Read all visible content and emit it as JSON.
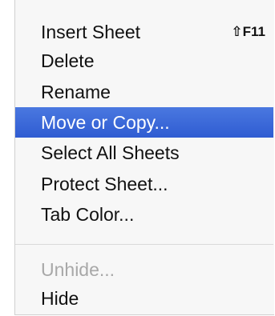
{
  "menu": {
    "items": [
      {
        "label": "Insert Sheet",
        "shortcut": "⇧F11",
        "enabled": true,
        "highlighted": false
      },
      {
        "label": "Delete",
        "enabled": true,
        "highlighted": false
      },
      {
        "label": "Rename",
        "enabled": true,
        "highlighted": false
      },
      {
        "label": "Move or Copy...",
        "enabled": true,
        "highlighted": true
      },
      {
        "label": "Select All Sheets",
        "enabled": true,
        "highlighted": false
      },
      {
        "label": "Protect Sheet...",
        "enabled": true,
        "highlighted": false
      },
      {
        "label": "Tab Color...",
        "enabled": true,
        "highlighted": false
      },
      {
        "label": "Unhide...",
        "enabled": false,
        "highlighted": false
      },
      {
        "label": "Hide",
        "enabled": true,
        "highlighted": false
      }
    ],
    "colors": {
      "highlight": "#3a66d8",
      "disabled_text": "#a8a8a8",
      "background": "#f7f7f7"
    }
  }
}
